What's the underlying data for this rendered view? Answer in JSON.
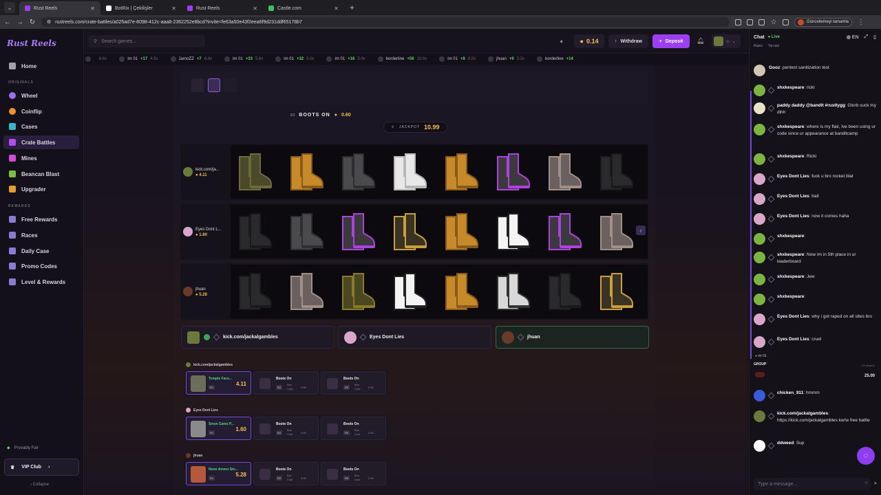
{
  "browser": {
    "tabs": [
      {
        "title": "Rust Reels",
        "active": true,
        "color": "#9b3ff0"
      },
      {
        "title": "BotRix | Çekilişler",
        "active": false,
        "color": "#ffffff"
      },
      {
        "title": "Rust Reels",
        "active": false,
        "color": "#9b3ff0"
      },
      {
        "title": "Castle.com",
        "active": false,
        "color": "#3fbf6a"
      }
    ],
    "url": "rustreels.com/crate-battles/a025ad7e-8098-412c-aaa8-2362252e8bcd?invite=fe63a50e43f2eea6f9d231ddf65178b7",
    "update_label": "Güncellemeyi tamamla"
  },
  "sidebar": {
    "logo": "Rust Reels",
    "items_top": [
      {
        "label": "Home",
        "icon": "home-icon",
        "color": "#a3a0ab"
      }
    ],
    "section_originals": "ORIGINALS",
    "originals": [
      {
        "label": "Wheel",
        "icon": "wheel-icon",
        "color": "#a06cf0"
      },
      {
        "label": "Coinflip",
        "icon": "coinflip-icon",
        "color": "#f0922a"
      },
      {
        "label": "Cases",
        "icon": "cases-icon",
        "color": "#35b8c8"
      },
      {
        "label": "Crate Battles",
        "icon": "crate-battles-icon",
        "color": "#b04cf0",
        "active": true
      },
      {
        "label": "Mines",
        "icon": "mines-icon",
        "color": "#d14ad8"
      },
      {
        "label": "Beancan Blast",
        "icon": "beancan-icon",
        "color": "#7bc043"
      },
      {
        "label": "Upgrader",
        "icon": "upgrader-icon",
        "color": "#e0a030"
      }
    ],
    "section_rewards": "REWARDS",
    "rewards": [
      {
        "label": "Free Rewards",
        "icon": "gift-icon",
        "color": "#8a7bd8"
      },
      {
        "label": "Races",
        "icon": "races-icon",
        "color": "#8a7bd8"
      },
      {
        "label": "Daily Case",
        "icon": "daily-case-icon",
        "color": "#8a7bd8"
      },
      {
        "label": "Promo Codes",
        "icon": "promo-icon",
        "color": "#8a7bd8"
      },
      {
        "label": "Level & Rewards",
        "icon": "level-icon",
        "color": "#8a7bd8"
      }
    ],
    "provably_fair": "Provably Fair",
    "vip": "VIP Club",
    "collapse": "Collapse"
  },
  "header": {
    "search_placeholder": "Search games...",
    "balance": "0.14",
    "withdraw": "Withdraw",
    "deposit": "Deposit"
  },
  "ticker": [
    {
      "user": "",
      "gain": "",
      "mult": "6.6x"
    },
    {
      "user": "im 01",
      "gain": "+17",
      "mult": "4.5x"
    },
    {
      "user": "JarnoZZ",
      "gain": "+7",
      "mult": "6.4x"
    },
    {
      "user": "im 01",
      "gain": "+33",
      "mult": "5.6x"
    },
    {
      "user": "im 01",
      "gain": "+32",
      "mult": "5.0x"
    },
    {
      "user": "im 01",
      "gain": "+16",
      "mult": "5.0x"
    },
    {
      "user": "borderline",
      "gain": "+56",
      "mult": "10.0x"
    },
    {
      "user": "im 01",
      "gain": "+8",
      "mult": "8.0x"
    },
    {
      "user": "jhuan",
      "gain": "+9",
      "mult": "3.2x"
    },
    {
      "user": "borderline",
      "gain": "+14",
      "mult": ""
    }
  ],
  "battle": {
    "round_label": "R3",
    "crate_name": "BOOTS ON",
    "crate_price": "0.60",
    "jackpot_label": "JACKPOT",
    "jackpot_value": "10.99",
    "reels": [
      {
        "player": "kick.com/ja...",
        "value": "4.11",
        "avatar_color": "#6b7a3a",
        "items": [
          "camo",
          "tan",
          "grey",
          "white",
          "tan",
          "purple",
          "speckled",
          "black",
          "black"
        ]
      },
      {
        "player": "Eyes Dont L...",
        "value": "1.60",
        "avatar_color": "#d8a6c8",
        "items": [
          "black",
          "grey",
          "purple",
          "leopard",
          "tan",
          "zebra",
          "purple",
          "speckled"
        ]
      },
      {
        "player": "jhuan",
        "value": "5.28",
        "avatar_color": "#6a3a2a",
        "items": [
          "black",
          "speckled",
          "olive",
          "zebra",
          "tan",
          "whiteblack",
          "black",
          "leopard"
        ]
      }
    ],
    "players": [
      {
        "name": "kick.com/jackalgambles",
        "avatar_color": "#6b7a3a",
        "verified": true,
        "winner": false
      },
      {
        "name": "Eyes Dont Lies",
        "avatar_color": "#d8a6c8",
        "verified": false,
        "winner": false
      },
      {
        "name": "jhuan",
        "avatar_color": "#6a3a2a",
        "verified": false,
        "winner": true
      }
    ]
  },
  "results": [
    {
      "player": "kick.com/jackalgambles",
      "won": {
        "name": "Temple Face...",
        "rarity": "R1",
        "value": "4.11",
        "color": "#6b6e5a"
      },
      "boxes": [
        {
          "name": "Boots On",
          "rarity": "R2",
          "sub": "Box Cost",
          "cost": "0.60"
        },
        {
          "name": "Boots On",
          "rarity": "R3",
          "sub": "Box Cost",
          "cost": "0.60"
        }
      ]
    },
    {
      "player": "Eyes Dont Lies",
      "won": {
        "name": "Snow Camo P...",
        "rarity": "R1",
        "value": "1.60",
        "color": "#8a8a8a"
      },
      "boxes": [
        {
          "name": "Boots On",
          "rarity": "R2",
          "sub": "Box Cost",
          "cost": "0.60"
        },
        {
          "name": "Boots On",
          "rarity": "R3",
          "sub": "Box Cost",
          "cost": "0.60"
        }
      ]
    },
    {
      "player": "jhuan",
      "won": {
        "name": "Neon Ammo Sto...",
        "rarity": "R1",
        "value": "5.28",
        "color": "#b4593a"
      },
      "boxes": [
        {
          "name": "Boots On",
          "rarity": "R2",
          "sub": "Box Cost",
          "cost": "0.60"
        },
        {
          "name": "Boots On",
          "rarity": "R3",
          "sub": "Box Cost",
          "cost": "0.60"
        }
      ]
    }
  ],
  "chat": {
    "title": "Chat",
    "live": "Live",
    "lang": "EN",
    "tabs": [
      "Rules",
      "Tip rain"
    ],
    "messages": [
      {
        "user": "Gooz",
        "text": "pentest sanitization test",
        "avatar": "#cfc7b0"
      },
      {
        "user": "shxkespeare",
        "text": "ricki",
        "avatar": "#7cb342"
      },
      {
        "user": "paddy daddy @bandit #rustlygg",
        "text": "Glorb suck my dihh",
        "avatar": "#e8e2c8"
      },
      {
        "user": "shxkespeare",
        "text": "where is my flair, Ive been using ur code since ur appearance at banditcamp",
        "avatar": "#7cb342"
      },
      {
        "user": "shxkespeare",
        "text": "Ricki",
        "avatar": "#7cb342"
      },
      {
        "user": "Eyes Dont Lies",
        "text": "fuck u bro rocket blat",
        "avatar": "#d8a6c8"
      },
      {
        "user": "Eyes Dont Lies",
        "text": "bait",
        "avatar": "#d8a6c8"
      },
      {
        "user": "Eyes Dont Lies",
        "text": "now it comes haha",
        "avatar": "#d8a6c8"
      },
      {
        "user": "shxkespeare",
        "text": "",
        "avatar": "#7cb342"
      },
      {
        "user": "shxkespeare",
        "text": "Now Im in 5th place in ur leaderboard",
        "avatar": "#7cb342"
      },
      {
        "user": "shxkespeare",
        "text": "Jew",
        "avatar": "#7cb342"
      },
      {
        "user": "shxkespeare",
        "text": "",
        "avatar": "#7cb342"
      },
      {
        "user": "Eyes Dont Lies",
        "text": "why i got raped on all sites bro",
        "avatar": "#d8a6c8"
      },
      {
        "user": "Eyes Dont Lies",
        "text": "cruel",
        "avatar": "#d8a6c8"
      }
    ],
    "group_user": "im 01",
    "group_label": "GROUP",
    "group_value": "25.00",
    "group_players": "2/2 players",
    "messages2": [
      {
        "user": "chicken_911",
        "text": "hmmm",
        "avatar": "#3a5bd8"
      },
      {
        "user": "kick.com/jackalgambles",
        "text": "https://kick.com/jackalgambles kw/w free battle",
        "avatar": "#6b7a3a"
      },
      {
        "user": "ddweed",
        "text": "Sup",
        "avatar": "#ffffff"
      }
    ],
    "input_placeholder": "Type a message..."
  }
}
